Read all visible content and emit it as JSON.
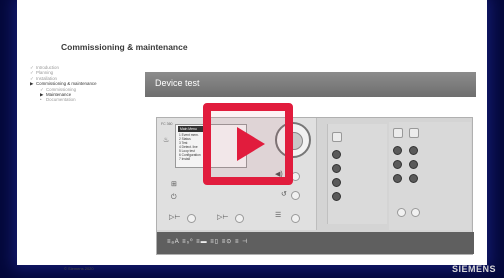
{
  "slide": {
    "title": "Commissioning & maintenance",
    "copyright": "© Siemens 2020"
  },
  "nav": [
    {
      "mark": "✓",
      "label": "Introduction",
      "sub": false,
      "active": false
    },
    {
      "mark": "✓",
      "label": "Planning",
      "sub": false,
      "active": false
    },
    {
      "mark": "✓",
      "label": "Installation",
      "sub": false,
      "active": false
    },
    {
      "mark": "▶",
      "label": "Commissioning & maintenance",
      "sub": false,
      "active": true
    },
    {
      "mark": "✓",
      "label": "Commissioning",
      "sub": true,
      "active": false
    },
    {
      "mark": "▶",
      "label": "Maintenance",
      "sub": true,
      "active": true
    },
    {
      "mark": "•",
      "label": "Documentation",
      "sub": true,
      "active": false
    }
  ],
  "device": {
    "header": "Device test",
    "menu_title": "Main Menu",
    "menu_lines": [
      "1 Event mem.",
      "2 Status",
      "3 Test",
      "4 Detect. line",
      "5 Loop test",
      "6 Configuration",
      "7 Install"
    ],
    "bottom_strip": "≡ₐA ≡₀⁰ ≡▬ ≡▯ ≡⊙ ≡ ⊣"
  },
  "video": {
    "action": "play"
  },
  "brand": "SIEMENS"
}
